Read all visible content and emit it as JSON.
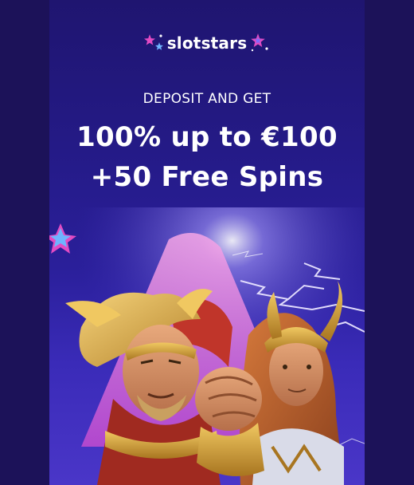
{
  "brand": {
    "name": "slotstars",
    "accent_pink": "#e24bc3",
    "accent_blue": "#6fb4ff"
  },
  "promo": {
    "lead": "DEPOSIT AND GET",
    "offer_line_1": "100% up to €100",
    "offer_line_2": "+50 Free Spins"
  },
  "colors": {
    "background": "#1c1259",
    "banner_top": "#1f1570",
    "banner_bottom": "#4a36c8"
  },
  "artwork": {
    "characters": [
      "winged-helmet-warrior",
      "horned-helmet-god"
    ],
    "icons": [
      "star-icon",
      "lightning-icon"
    ]
  }
}
